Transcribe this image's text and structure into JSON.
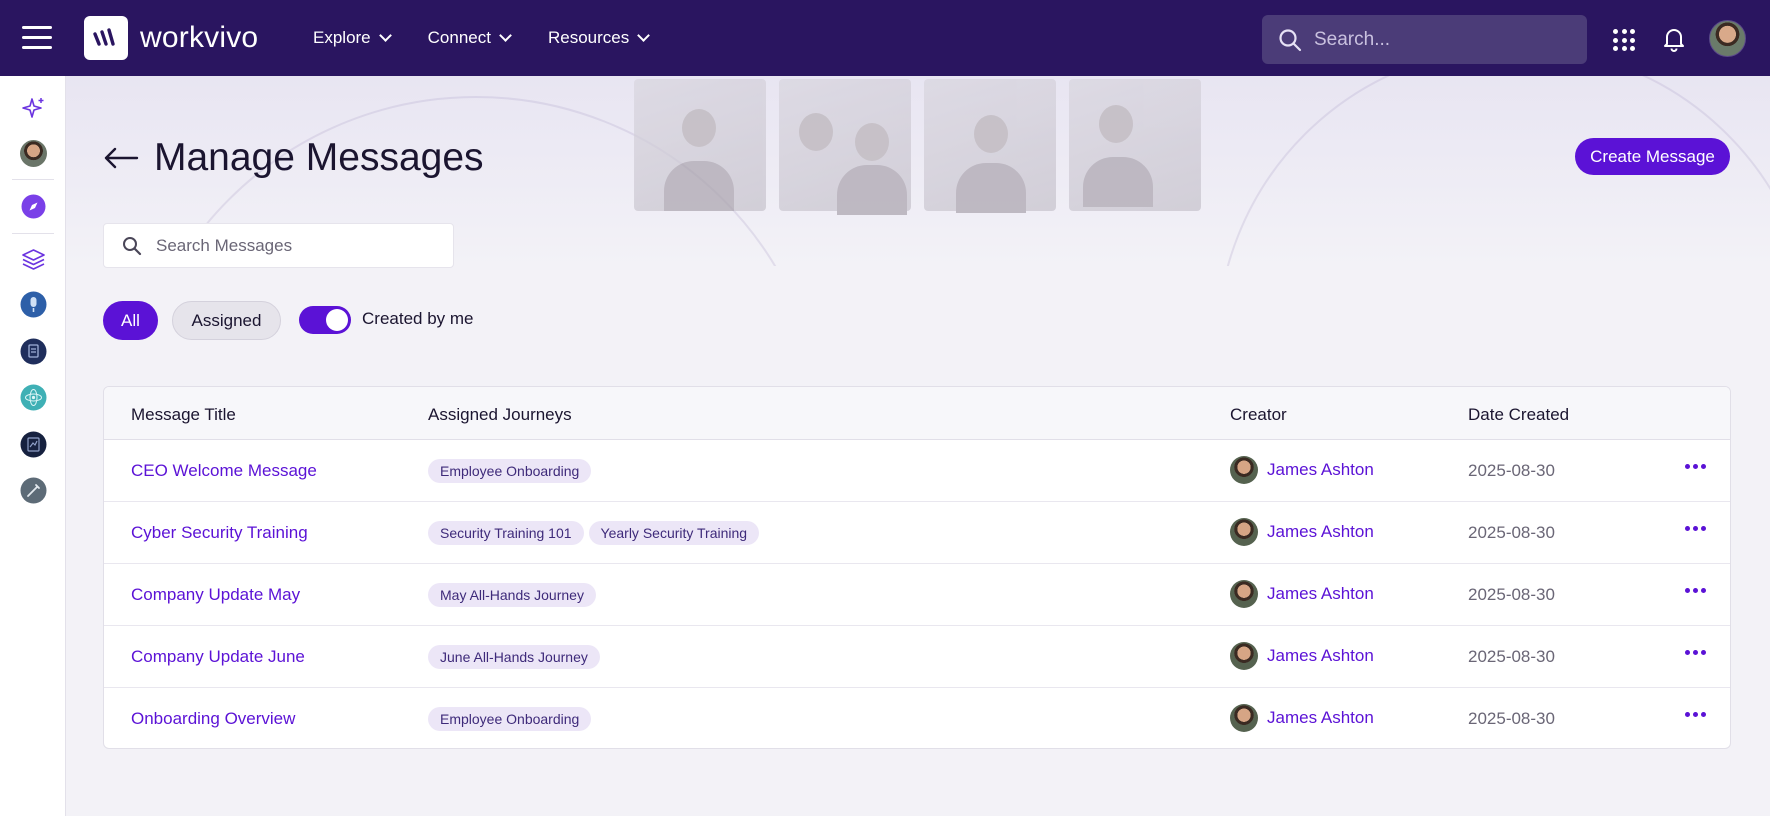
{
  "topbar": {
    "logo_text": "workvivo",
    "nav": [
      {
        "label": "Explore"
      },
      {
        "label": "Connect"
      },
      {
        "label": "Resources"
      }
    ],
    "search_placeholder": "Search...",
    "accent_color": "#2a1560"
  },
  "page": {
    "title": "Manage Messages",
    "create_button": "Create Message",
    "search_placeholder": "Search Messages",
    "filters": {
      "all": "All",
      "assigned": "Assigned",
      "created_by_me": "Created by me",
      "created_by_me_on": true
    }
  },
  "table": {
    "headers": {
      "title": "Message Title",
      "journeys": "Assigned Journeys",
      "creator": "Creator",
      "date": "Date Created"
    },
    "rows": [
      {
        "title": "CEO Welcome Message",
        "journeys": [
          "Employee Onboarding"
        ],
        "creator": "James Ashton",
        "date": "2025-08-30"
      },
      {
        "title": "Cyber Security Training",
        "journeys": [
          "Security Training 101",
          "Yearly Security Training"
        ],
        "creator": "James Ashton",
        "date": "2025-08-30"
      },
      {
        "title": "Company Update May",
        "journeys": [
          "May All-Hands Journey"
        ],
        "creator": "James Ashton",
        "date": "2025-08-30"
      },
      {
        "title": "Company Update June",
        "journeys": [
          "June All-Hands Journey"
        ],
        "creator": "James Ashton",
        "date": "2025-08-30"
      },
      {
        "title": "Onboarding Overview",
        "journeys": [
          "Employee Onboarding"
        ],
        "creator": "James Ashton",
        "date": "2025-08-30"
      }
    ]
  },
  "colors": {
    "primary": "#5b12d6",
    "topbar": "#2a1560"
  },
  "icons": {
    "menu": "hamburger-icon",
    "search": "search-icon",
    "apps": "apps-grid-icon",
    "notifications": "bell-icon",
    "back": "back-arrow-icon",
    "row_actions": "more-horizontal-icon"
  }
}
